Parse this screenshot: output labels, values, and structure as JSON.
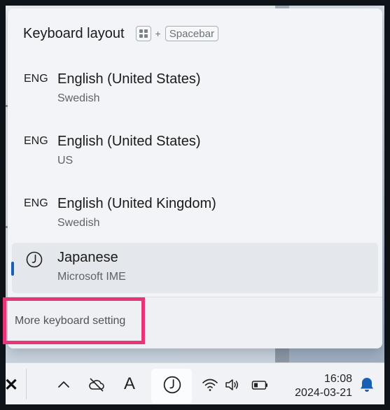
{
  "flyout": {
    "title": "Keyboard layout",
    "shortcut_plus": "+",
    "shortcut_key": "Spacebar",
    "items": [
      {
        "abbr": "ENG",
        "name": "English (United States)",
        "sub": "Swedish",
        "selected": false
      },
      {
        "abbr": "ENG",
        "name": "English (United States)",
        "sub": "US",
        "selected": false
      },
      {
        "abbr": "ENG",
        "name": "English (United Kingdom)",
        "sub": "Swedish",
        "selected": false
      },
      {
        "abbr": "",
        "icon": "ime-japanese-icon",
        "name": "Japanese",
        "sub": "Microsoft IME",
        "selected": true
      }
    ],
    "more_settings": "More keyboard setting"
  },
  "taskbar": {
    "left_icon": "close-x-icon",
    "icons": [
      "chevron-up-icon",
      "cloud-offline-icon",
      "ime-a-icon",
      "ime-japanese-icon",
      "wifi-icon",
      "volume-icon",
      "battery-icon"
    ],
    "ime_letter": "A",
    "time": "16:08",
    "date": "2024-03-21",
    "notification_icon": "bell-icon"
  },
  "colors": {
    "accent": "#1a5fb4",
    "highlight_border": "#e8357a",
    "notification": "#1a5fb4"
  }
}
